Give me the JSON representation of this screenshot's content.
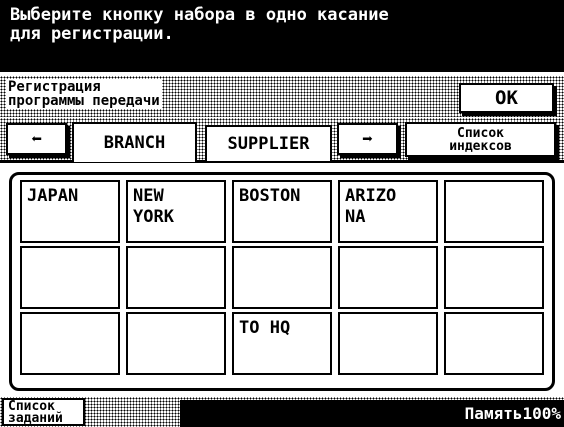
{
  "header": {
    "instruction": "Выберите кнопку набора в одно касание\nдля регистрации."
  },
  "registration": {
    "label": "Регистрация\nпрограммы передачи",
    "ok_label": "OK"
  },
  "tabs": {
    "prev_label": "⬅",
    "next_label": "➡",
    "items": [
      {
        "label": "BRANCH",
        "selected": true
      },
      {
        "label": "SUPPLIER",
        "selected": false
      }
    ],
    "index_label": "Список\nиндексов"
  },
  "grid": {
    "cells": [
      "JAPAN",
      "NEW\nYORK",
      "BOSTON",
      "ARIZO\nNA",
      "",
      "",
      "",
      "",
      "",
      "",
      "",
      "",
      "TO HQ",
      "",
      ""
    ]
  },
  "footer": {
    "jobs_label": "Список\nзаданий",
    "memory": "Память100%"
  }
}
